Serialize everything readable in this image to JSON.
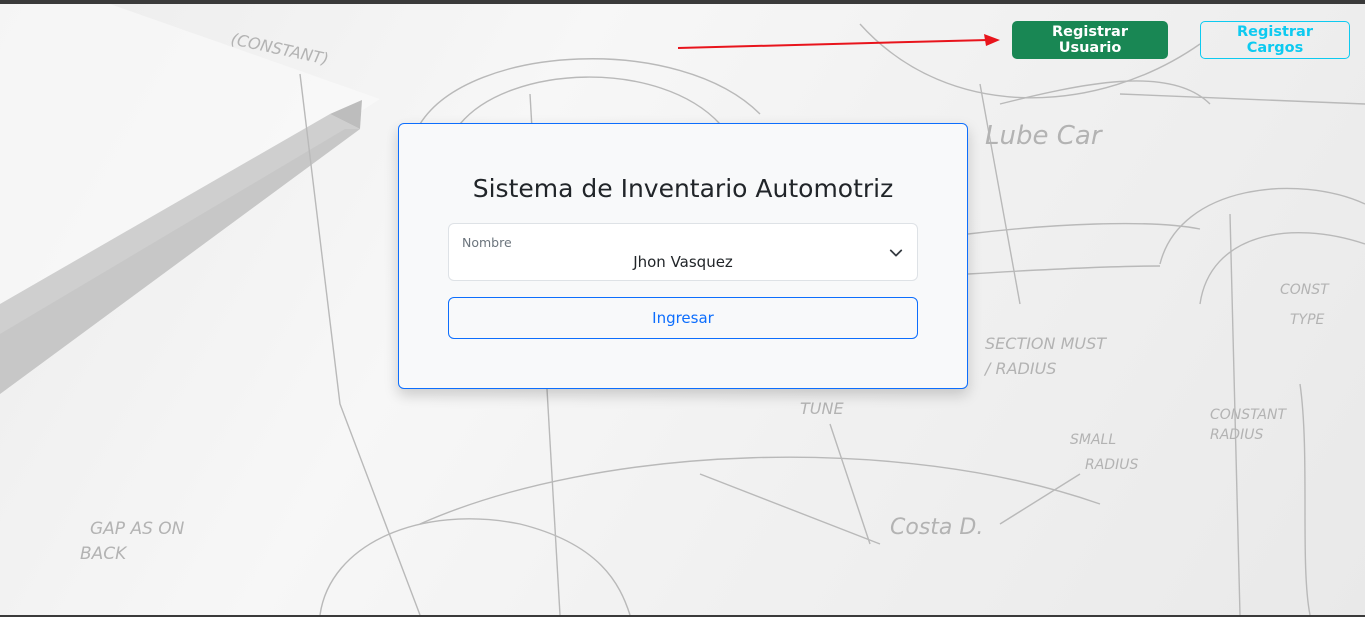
{
  "header": {
    "register_user_label": "Registrar Usuario",
    "register_positions_label": "Registrar Cargos"
  },
  "login": {
    "title": "Sistema de Inventario Automotriz",
    "select_label": "Nombre",
    "select_value": "Jhon Vasquez",
    "submit_label": "Ingresar"
  },
  "colors": {
    "success": "#198754",
    "info": "#0dcaf0",
    "primary": "#0d6efd",
    "annotation_arrow": "#e8141c"
  },
  "icons": {
    "select_caret": "chevron-down-icon",
    "annotation": "red-arrow"
  }
}
